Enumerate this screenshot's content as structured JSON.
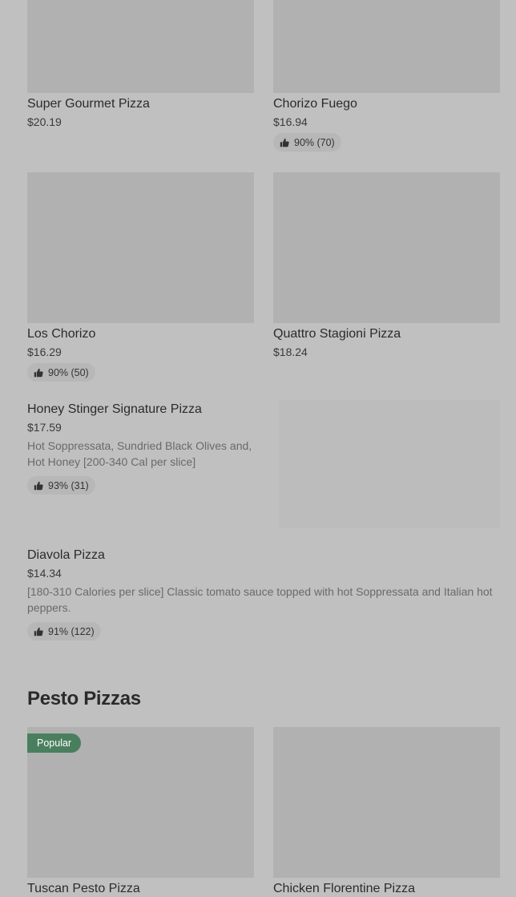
{
  "grid_row_1": [
    {
      "name": "Super Gourmet Pizza",
      "price": "$20.19",
      "rating": ""
    },
    {
      "name": "Chorizo Fuego",
      "price": "$16.94",
      "rating": "90% (70)"
    }
  ],
  "grid_row_2": [
    {
      "name": "Los Chorizo",
      "price": "$16.29",
      "rating": "90% (50)"
    },
    {
      "name": "Quattro Stagioni Pizza",
      "price": "$18.24",
      "rating": ""
    }
  ],
  "list_items": [
    {
      "name": "Honey Stinger Signature Pizza",
      "price": "$17.59",
      "description": "Hot Soppressata, Sundried Black Olives and, Hot Honey [200-340 Cal per slice]",
      "rating": "93% (31)"
    },
    {
      "name": "Diavola Pizza",
      "price": "$14.34",
      "description": "[180-310 Calories per slice] Classic tomato sauce topped with hot Soppressata and Italian hot peppers.",
      "rating": "91% (122)"
    }
  ],
  "section": {
    "title": "Pesto Pizzas"
  },
  "grid_row_3": [
    {
      "name": "Tuscan Pesto Pizza",
      "badge": "Popular"
    },
    {
      "name": "Chicken Florentine Pizza"
    }
  ],
  "colors": {
    "background": "#c0c0c0",
    "badge": "#4a7f5e",
    "thumb": "#b1b1b1"
  },
  "icons": {
    "rating": "thumbs-up-icon"
  }
}
